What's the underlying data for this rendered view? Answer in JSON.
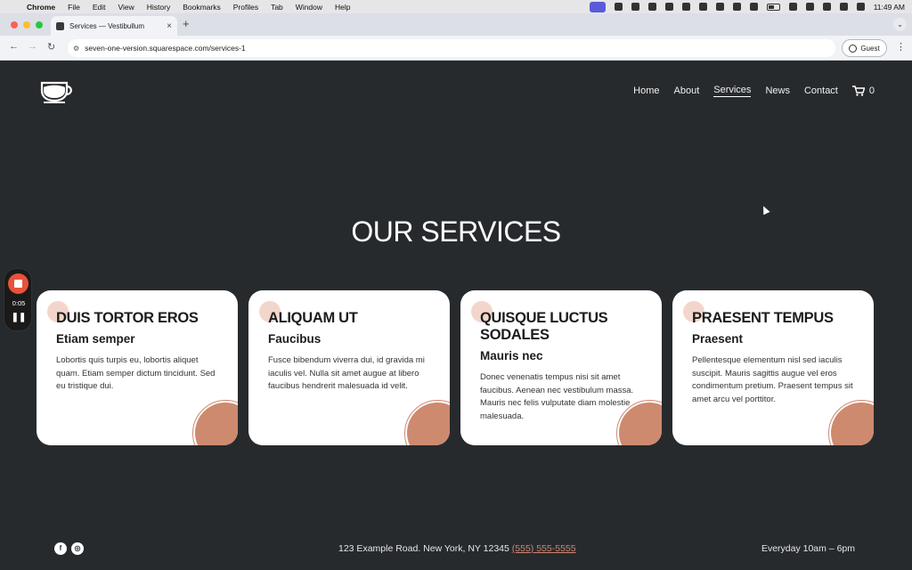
{
  "menubar": {
    "app": "Chrome",
    "items": [
      "File",
      "Edit",
      "View",
      "History",
      "Bookmarks",
      "Profiles",
      "Tab",
      "Window",
      "Help"
    ],
    "clock": "11:49 AM"
  },
  "browser": {
    "tab_title": "Services — Vestibullum",
    "url": "seven-one-version.squarespace.com/services-1",
    "profile": "Guest"
  },
  "site": {
    "nav": [
      "Home",
      "About",
      "Services",
      "News",
      "Contact"
    ],
    "active_nav": "Services",
    "cart_count": "0",
    "page_title": "OUR SERVICES",
    "cards": [
      {
        "title": "DUIS TORTOR EROS",
        "subtitle": "Etiam semper",
        "body": "Lobortis quis turpis eu, lobortis aliquet quam. Etiam semper dictum tincidunt. Sed eu tristique dui."
      },
      {
        "title": "ALIQUAM UT",
        "subtitle": "Faucibus",
        "body": "Fusce bibendum viverra dui, id gravida mi iaculis vel. Nulla sit amet augue at libero faucibus hendrerit malesuada id velit."
      },
      {
        "title": "QUISQUE LUCTUS SODALES",
        "subtitle": "Mauris nec",
        "body": "Donec venenatis tempus nisi sit amet faucibus. Aenean nec vestibulum massa. Mauris nec felis vulputate diam molestie malesuada."
      },
      {
        "title": "PRAESENT TEMPUS",
        "subtitle": "Praesent",
        "body": "Pellentesque elementum nisl sed iaculis suscipit. Mauris sagittis augue vel eros condimentum pretium. Praesent tempus sit amet arcu vel porttitor."
      }
    ],
    "footer": {
      "address": "123 Example Road. New York, NY 12345",
      "phone": "(555) 555-5555",
      "hours": "Everyday 10am – 6pm"
    }
  },
  "recorder": {
    "time": "0:05"
  },
  "colors": {
    "background": "#272a2d",
    "accent": "#cd8a6e",
    "card": "#ffffff"
  }
}
